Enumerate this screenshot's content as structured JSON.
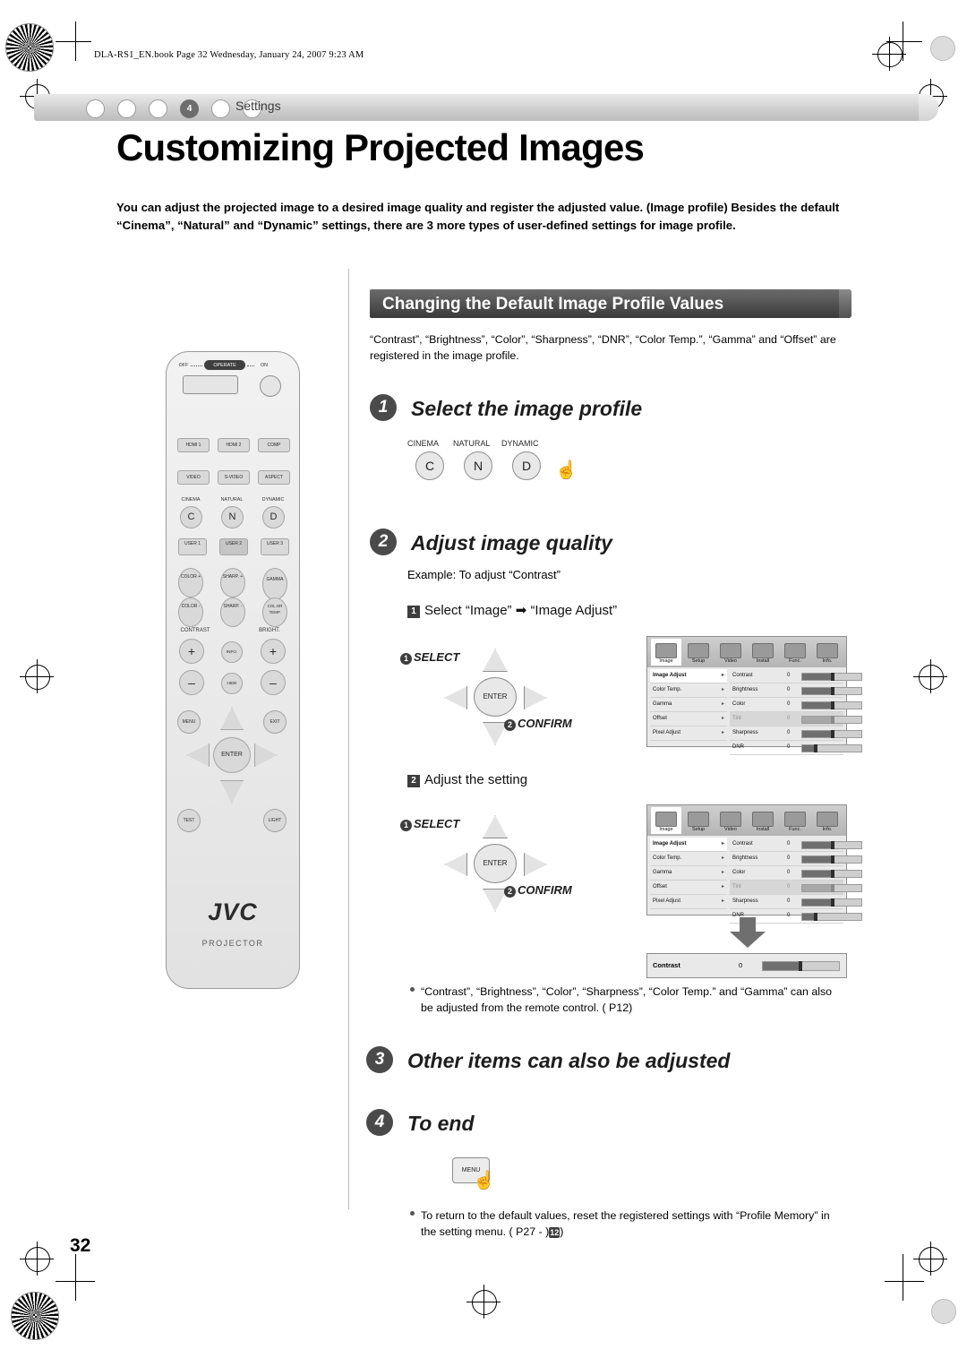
{
  "header": {
    "file_line": "DLA-RS1_EN.book  Page 32  Wednesday, January 24, 2007  9:23 AM",
    "tab_label": "Settings",
    "tab_current": "4"
  },
  "title": "Customizing Projected Images",
  "intro": "You can adjust the projected image to a desired image quality and register the adjusted value. (Image profile) Besides the default “Cinema”, “Natural” and “Dynamic” settings, there are 3 more types of user-defined settings for image profile.",
  "section": {
    "banner": "Changing the Default Image Profile Values",
    "note": "“Contrast”, “Brightness”, “Color”, “Sharpness”, “DNR”, “Color Temp.”, “Gamma” and “Offset” are registered in the image profile."
  },
  "steps": [
    {
      "num": "1",
      "title": "Select the image profile"
    },
    {
      "num": "2",
      "title": "Adjust image quality"
    },
    {
      "num": "3",
      "title": "Other items can also be adjusted"
    },
    {
      "num": "4",
      "title": "To end"
    }
  ],
  "profile_buttons": {
    "captions": [
      "CINEMA",
      "NATURAL",
      "DYNAMIC"
    ],
    "letters": [
      "C",
      "N",
      "D"
    ]
  },
  "step2": {
    "example": "Example: To adjust “Contrast”",
    "sub1": "Select “Image”  ➡  “Image Adjust”",
    "sub1_num": "1",
    "sub2": "Adjust the setting",
    "sub2_num": "2",
    "select_label": "SELECT",
    "confirm_label": "CONFIRM",
    "enter_label": "ENTER",
    "num1": "1",
    "num2": "2"
  },
  "osd": {
    "tabs": [
      "Image",
      "Setup",
      "Video",
      "Install",
      "Func.",
      "Info."
    ],
    "left_items": [
      "Image Adjust",
      "Color Temp.",
      "Gamma",
      "Offset",
      "Pixel Adjust"
    ],
    "right_items": [
      {
        "name": "Contrast",
        "value": "0"
      },
      {
        "name": "Brightness",
        "value": "0"
      },
      {
        "name": "Color",
        "value": "0"
      },
      {
        "name": "Tint",
        "value": "0"
      },
      {
        "name": "Sharpness",
        "value": "0"
      },
      {
        "name": "DNR",
        "value": "0"
      }
    ],
    "contrast_box": {
      "name": "Contrast",
      "value": "0"
    }
  },
  "notes": {
    "remote_note": "“Contrast”, “Brightness”, “Color”, “Sharpness”, “Color Temp.” and “Gamma” can also be adjusted from the remote control. (     P12)",
    "reset_note": "To return to the default values, reset the registered settings with “Profile Memory” in the setting menu. (     P27 -     )",
    "reset_note_badge": "12"
  },
  "remote": {
    "power": {
      "off": "OFF",
      "operate": "OPERATE",
      "on": "ON"
    },
    "rows": [
      [
        "HDMI 1",
        "HDMI 2",
        "COMP"
      ],
      [
        "VIDEO",
        "S-VIDEO",
        "ASPECT"
      ]
    ],
    "profile_caps": [
      "CINEMA",
      "NATURAL",
      "DYNAMIC"
    ],
    "profile_letters": [
      "C",
      "N",
      "D"
    ],
    "user_buttons": [
      "USER 1",
      "USER 2",
      "USER 3"
    ],
    "color_buttons": [
      "COLOR +",
      "SHARP. +",
      "GAMMA",
      "COLOR -",
      "SHARP. -",
      "COL.OR TEMP."
    ],
    "ct_labels": [
      "CONTRAST",
      "BRIGHT."
    ],
    "plus": "+",
    "minus": "–",
    "info": "INFO.",
    "hide": "HIDE",
    "menu": "MENU",
    "exit": "EXIT",
    "enter": "ENTER",
    "test": "TEST",
    "light": "LIGHT",
    "brand": "JVC",
    "model": "PROJECTOR"
  },
  "page_number": "32"
}
